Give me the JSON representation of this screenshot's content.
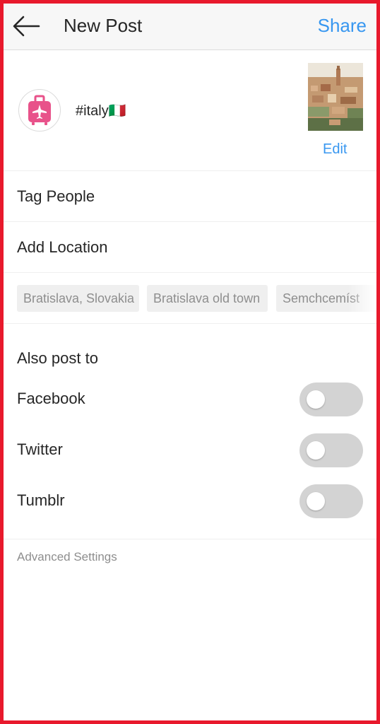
{
  "header": {
    "title": "New Post",
    "share_label": "Share",
    "back_icon": "arrow-left-icon"
  },
  "compose": {
    "avatar_icon": "luggage-airplane-icon",
    "caption": "#italy🇮🇹",
    "edit_label": "Edit"
  },
  "options": {
    "tag_people": "Tag People",
    "add_location": "Add Location"
  },
  "location_suggestions": [
    "Bratislava, Slovakia",
    "Bratislava old town",
    "Semchcemíst"
  ],
  "share_to": {
    "title": "Also post to",
    "targets": [
      {
        "label": "Facebook",
        "enabled": false
      },
      {
        "label": "Twitter",
        "enabled": false
      },
      {
        "label": "Tumblr",
        "enabled": false
      }
    ]
  },
  "advanced_settings": "Advanced Settings",
  "colors": {
    "accent": "#3897f0",
    "frame": "#e8192c",
    "avatar_pink": "#e8528a",
    "toggle_off": "#d3d3d3"
  }
}
